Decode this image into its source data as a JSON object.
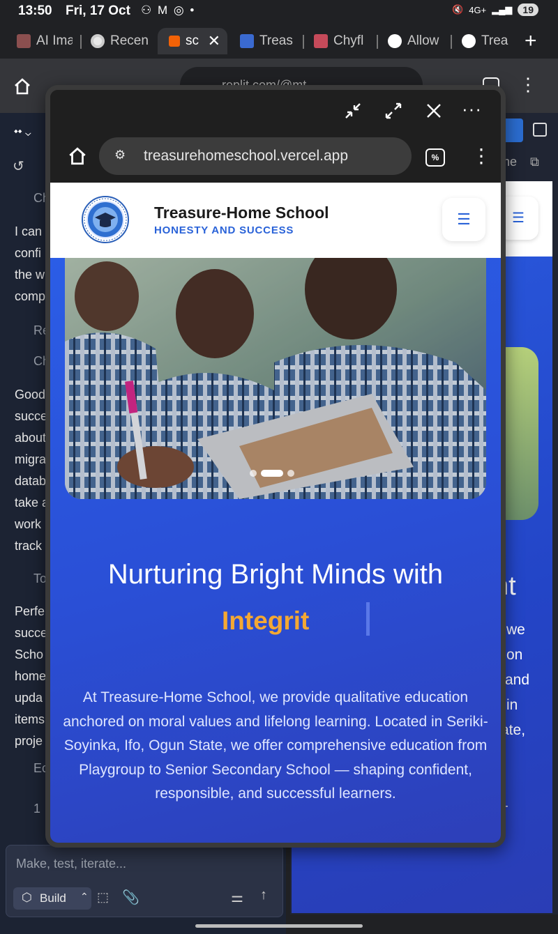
{
  "status_bar": {
    "time": "13:50",
    "date": "Fri, 17 Oct",
    "notification_icons": "⚇ M ◎ •",
    "network": "4G+",
    "battery": "19"
  },
  "tabs": [
    {
      "label": "AI Ima",
      "favicon_color": "#8b4f4f"
    },
    {
      "label": "Recen",
      "favicon_color": "#e8e8e8"
    },
    {
      "label": "sc",
      "favicon_color": "#f26207"
    },
    {
      "label": "Treas",
      "favicon_color": "#3a6ad0"
    },
    {
      "label": "Chyfl",
      "favicon_color": "#c54a5a"
    },
    {
      "label": "Allow",
      "favicon_color": "#ffffff"
    },
    {
      "label": "Trea",
      "favicon_color": "#ffffff"
    }
  ],
  "background_browser": {
    "url": "replit.com/@mt"
  },
  "replit_panel": {
    "lines": [
      {
        "text": "Ch",
        "muted": true
      },
      {
        "text": "I can",
        "muted": false
      },
      {
        "text": "confi",
        "muted": false
      },
      {
        "text": "the w",
        "muted": false
      },
      {
        "text": "comp",
        "muted": false
      },
      {
        "text": "Re",
        "muted": true
      },
      {
        "text": "Ch",
        "muted": true
      },
      {
        "text": "Good",
        "muted": false
      },
      {
        "text": "succe",
        "muted": false
      },
      {
        "text": "about",
        "muted": false
      },
      {
        "text": "migra",
        "muted": false
      },
      {
        "text": "datab",
        "muted": false
      },
      {
        "text": "take a",
        "muted": false
      },
      {
        "text": "work",
        "muted": false
      },
      {
        "text": "track",
        "muted": false
      },
      {
        "text": "To",
        "muted": true
      },
      {
        "text": "Perfe",
        "muted": false
      },
      {
        "text": "succe",
        "muted": false
      },
      {
        "text": "Scho",
        "muted": false
      },
      {
        "text": "home",
        "muted": false
      },
      {
        "text": "upda",
        "muted": false
      },
      {
        "text": "items",
        "muted": false
      },
      {
        "text": "proje",
        "muted": false
      },
      {
        "text": "Ec",
        "muted": true
      },
      {
        "text": "1",
        "muted": true
      }
    ],
    "chat_placeholder": "Make, test, iterate...",
    "build_label": "Build"
  },
  "preview_pane": {
    "tab_label": "me",
    "heading_fragment": "nt",
    "lines": [
      "we",
      "on",
      "and",
      "in",
      "ate,",
      "we offer comprehensive",
      "education from Playgroup to",
      "Senior Secondary School —"
    ]
  },
  "popup": {
    "url": "treasurehomeschool.vercel.app",
    "site": {
      "title": "Treasure-Home School",
      "tagline": "HONESTY AND SUCCESS",
      "logo_text": "TREASURE-HOME SCHOOL",
      "menu_icon": "☰"
    },
    "hero": {
      "heading": "Nurturing Bright Minds with",
      "typed_word": "Integrit",
      "paragraph": "At Treasure-Home School, we provide qualitative education anchored on moral values and lifelong learning. Located in Seriki-Soyinka, Ifo, Ogun State, we offer comprehensive education from Playgroup to Senior Secondary School — shaping confident, responsible, and successful learners.",
      "carousel": {
        "count": 3,
        "active": 2
      }
    }
  }
}
